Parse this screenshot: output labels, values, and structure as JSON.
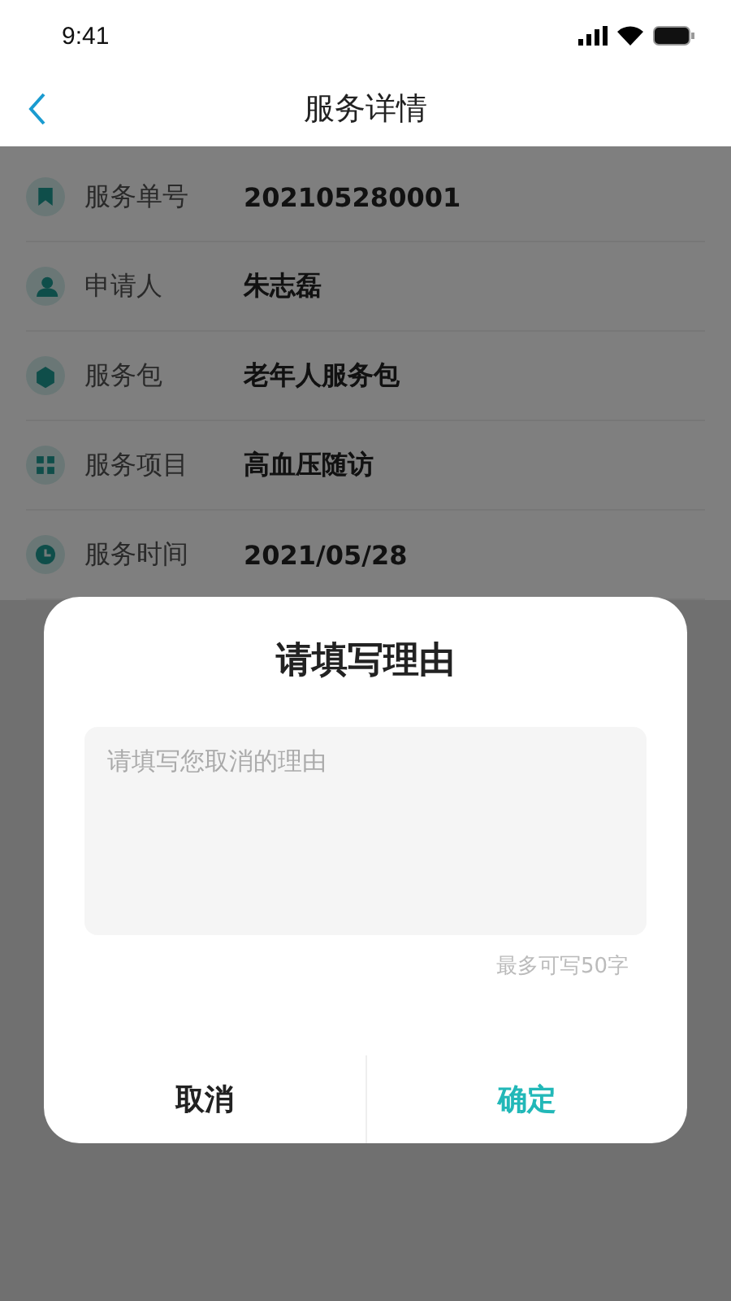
{
  "status_bar": {
    "time": "9:41"
  },
  "nav": {
    "title": "服务详情"
  },
  "details": [
    {
      "kind": "bookmark",
      "label": "服务单号",
      "value": "202105280001"
    },
    {
      "kind": "person",
      "label": "申请人",
      "value": "朱志磊"
    },
    {
      "kind": "box",
      "label": "服务包",
      "value": "老年人服务包"
    },
    {
      "kind": "grid",
      "label": "服务项目",
      "value": "高血压随访"
    },
    {
      "kind": "clock",
      "label": "服务时间",
      "value": "2021/05/28"
    }
  ],
  "dialog": {
    "title": "请填写理由",
    "reason_field": {
      "placeholder": "请填写您取消的理由"
    },
    "limit_hint": "最多可写50字",
    "buttons": [
      {
        "kind": "cancel",
        "label": "取消"
      },
      {
        "kind": "confirm",
        "label": "确定"
      }
    ]
  }
}
